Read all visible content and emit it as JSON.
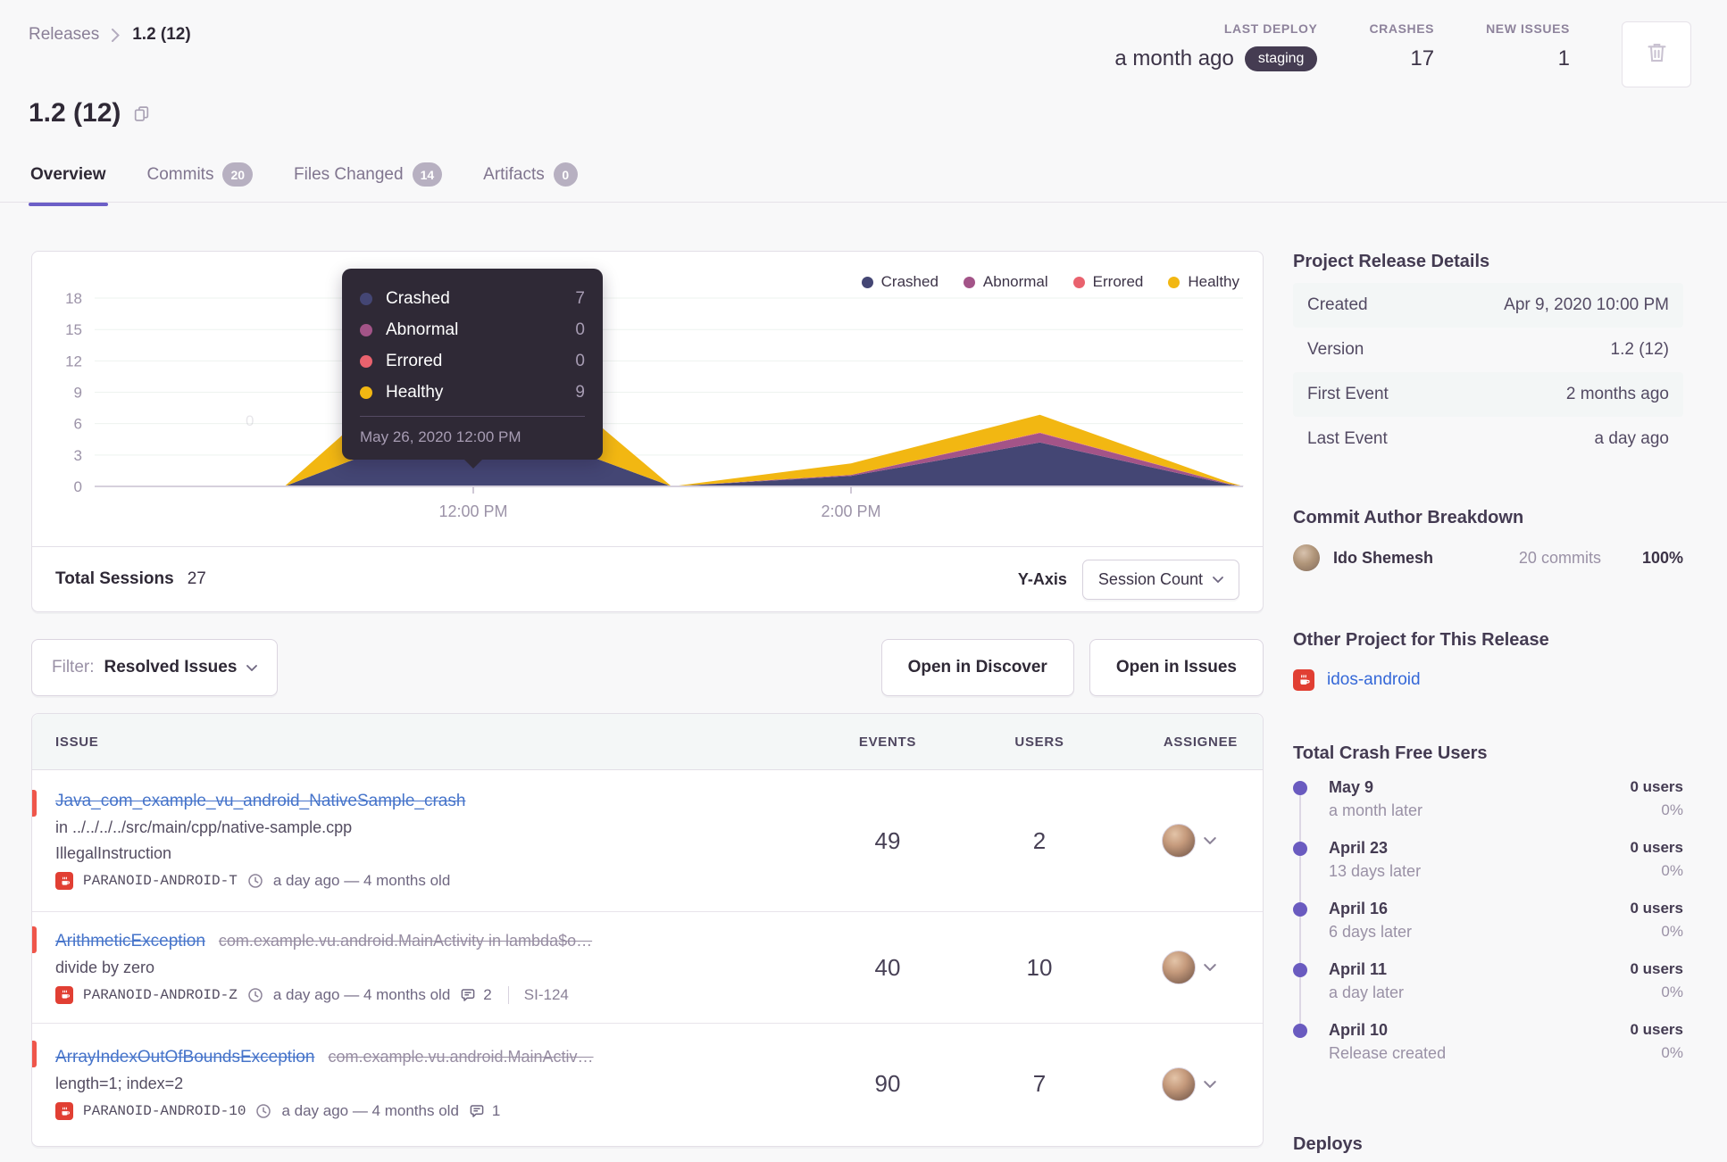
{
  "breadcrumb": {
    "parent": "Releases",
    "current": "1.2 (12)"
  },
  "header": {
    "stats": [
      {
        "label": "LAST DEPLOY",
        "value": "a month ago",
        "badge": "staging"
      },
      {
        "label": "CRASHES",
        "value": "17"
      },
      {
        "label": "NEW ISSUES",
        "value": "1"
      }
    ]
  },
  "title": "1.2 (12)",
  "tabs": [
    {
      "label": "Overview"
    },
    {
      "label": "Commits",
      "badge": "20"
    },
    {
      "label": "Files Changed",
      "badge": "14"
    },
    {
      "label": "Artifacts",
      "badge": "0"
    }
  ],
  "chart": {
    "type": "area",
    "stacked": true,
    "y_ticks": [
      18,
      15,
      12,
      9,
      6,
      3,
      0
    ],
    "x_ticks": [
      {
        "hour": 12,
        "label": "12:00 PM"
      },
      {
        "hour": 14,
        "label": "2:00 PM"
      }
    ],
    "x_hours": [
      9.97,
      11,
      12,
      13.05,
      14,
      15,
      16,
      16.08
    ],
    "series": [
      {
        "name": "Crashed",
        "color": "#444674",
        "values": [
          0,
          0,
          7,
          0,
          1.0,
          4.2,
          0.2,
          0
        ]
      },
      {
        "name": "Abnormal",
        "color": "#a35488",
        "values": [
          0,
          0,
          0,
          0,
          0.1,
          0.9,
          0.05,
          0
        ]
      },
      {
        "name": "Errored",
        "color": "#e9626e",
        "values": [
          0,
          0,
          0,
          0,
          0,
          0.05,
          0,
          0
        ]
      },
      {
        "name": "Healthy",
        "color": "#f2b712",
        "values": [
          0,
          0,
          9,
          0,
          1.1,
          1.7,
          0.15,
          0
        ]
      }
    ],
    "ghost_label": "0",
    "tooltip": {
      "rows": [
        {
          "name": "Crashed",
          "value": "7"
        },
        {
          "name": "Abnormal",
          "value": "0"
        },
        {
          "name": "Errored",
          "value": "0"
        },
        {
          "name": "Healthy",
          "value": "9"
        }
      ],
      "date": "May 26, 2020 12:00 PM",
      "anchor_hour": 12
    },
    "footer": {
      "sessions_label": "Total Sessions",
      "sessions_value": "27",
      "y_axis_label": "Y-Axis",
      "y_axis_value": "Session Count"
    }
  },
  "toolbar": {
    "filter_label": "Filter:",
    "filter_value": "Resolved Issues",
    "open_discover": "Open in Discover",
    "open_issues": "Open in Issues"
  },
  "issues": {
    "columns": [
      "ISSUE",
      "EVENTS",
      "USERS",
      "ASSIGNEE"
    ],
    "rows": [
      {
        "title": "Java_com_example_vu_android_NativeSample_crash",
        "location": "in ../../../../src/main/cpp/native-sample.cpp",
        "subtitle": "IllegalInstruction",
        "project": "PARANOID-ANDROID-T",
        "age": "a day ago — 4 months old",
        "events": "49",
        "users": "2"
      },
      {
        "title": "ArithmeticException",
        "culprit": "com.example.vu.android.MainActivity in lambda$o…",
        "subtitle": "divide by zero",
        "project": "PARANOID-ANDROID-Z",
        "age": "a day ago — 4 months old",
        "comments": "2",
        "ticket": "SI-124",
        "events": "40",
        "users": "10"
      },
      {
        "title": "ArrayIndexOutOfBoundsException",
        "culprit": "com.example.vu.android.MainActiv…",
        "subtitle": "length=1; index=2",
        "project": "PARANOID-ANDROID-10",
        "age": "a day ago — 4 months old",
        "comments": "1",
        "events": "90",
        "users": "7"
      }
    ]
  },
  "sidebar": {
    "release_details": {
      "title": "Project Release Details",
      "rows": [
        {
          "label": "Created",
          "value": "Apr 9, 2020 10:00 PM"
        },
        {
          "label": "Version",
          "value": "1.2 (12)"
        },
        {
          "label": "First Event",
          "value": "2 months ago"
        },
        {
          "label": "Last Event",
          "value": "a day ago"
        }
      ]
    },
    "commit_authors": {
      "title": "Commit Author Breakdown",
      "name": "Ido Shemesh",
      "commits": "20 commits",
      "percent": "100%"
    },
    "other_project": {
      "title": "Other Project for This Release",
      "link": "idos-android"
    },
    "crash_free": {
      "title": "Total Crash Free Users",
      "items": [
        {
          "date": "May 9",
          "note": "a month later",
          "users": "0 users",
          "percent": "0%"
        },
        {
          "date": "April 23",
          "note": "13 days later",
          "users": "0 users",
          "percent": "0%"
        },
        {
          "date": "April 16",
          "note": "6 days later",
          "users": "0 users",
          "percent": "0%"
        },
        {
          "date": "April 11",
          "note": "a day later",
          "users": "0 users",
          "percent": "0%"
        },
        {
          "date": "April 10",
          "note": "Release created",
          "users": "0 users",
          "percent": "0%"
        }
      ]
    },
    "deploys_title": "Deploys"
  }
}
